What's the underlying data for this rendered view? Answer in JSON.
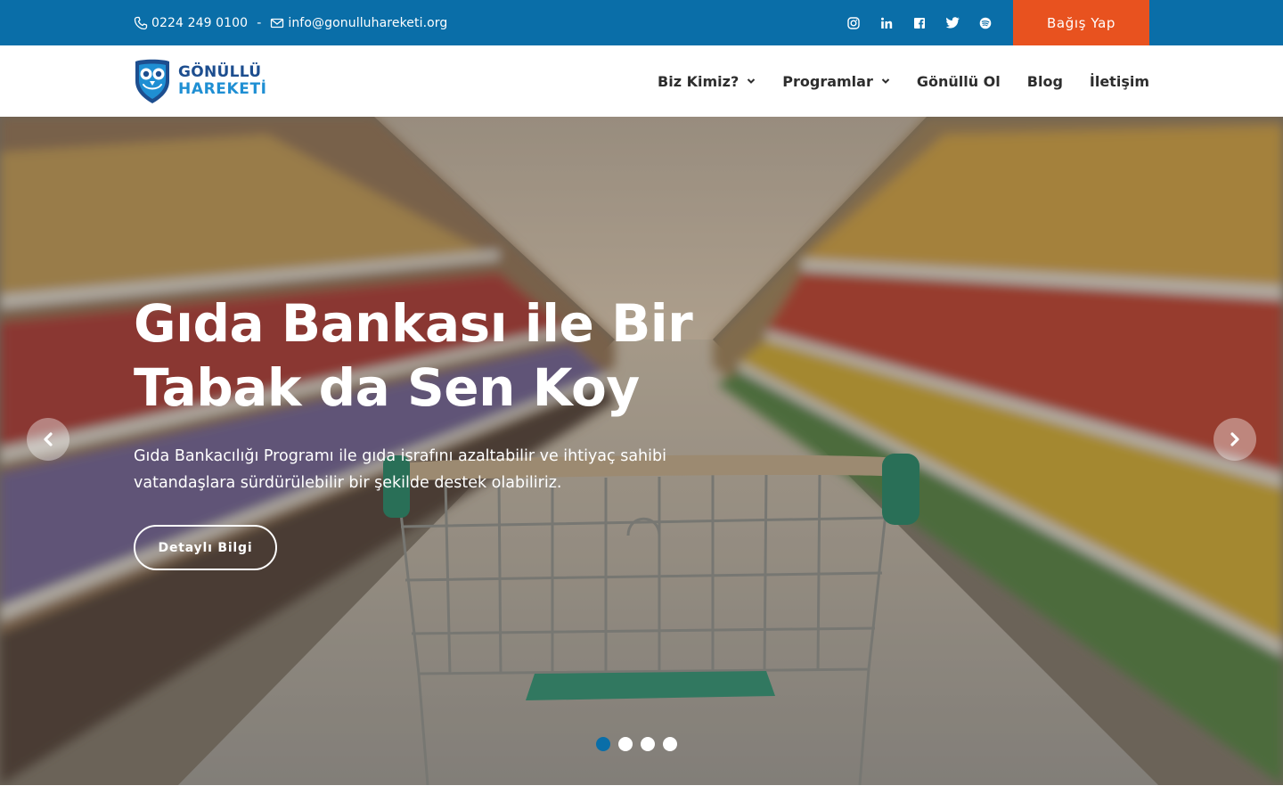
{
  "topbar": {
    "phone": "0224 249 0100",
    "separator": "-",
    "email": "info@gonulluhareketi.org",
    "phone_icon": "phone-icon",
    "email_icon": "envelope-icon",
    "socials": [
      "instagram-icon",
      "linkedin-icon",
      "facebook-icon",
      "twitter-icon",
      "spotify-icon"
    ],
    "donate_label": "Bağış Yap",
    "background_color": "#0a6ea8",
    "donate_color": "#e8521f"
  },
  "header": {
    "logo": {
      "line1": "GÖNÜLLÜ",
      "line2": "HAREKETİ"
    },
    "nav": [
      {
        "label": "Biz Kimiz?",
        "dropdown": true
      },
      {
        "label": "Programlar",
        "dropdown": true
      },
      {
        "label": "Gönüllü Ol",
        "dropdown": false
      },
      {
        "label": "Blog",
        "dropdown": false
      },
      {
        "label": "İletişim",
        "dropdown": false
      }
    ]
  },
  "hero": {
    "title": "Gıda Bankası ile Bir Tabak da Sen Koy",
    "description": "Gıda Bankacılığı Programı ile gıda israfını azaltabilir ve ihtiyaç sahibi vatandaşlara sürdürülebilir bir şekilde destek olabiliriz.",
    "button_label": "Detaylı Bilgi",
    "prev_icon": "chevron-left-icon",
    "next_icon": "chevron-right-icon",
    "slides_total": 4,
    "slide_active": 1
  }
}
